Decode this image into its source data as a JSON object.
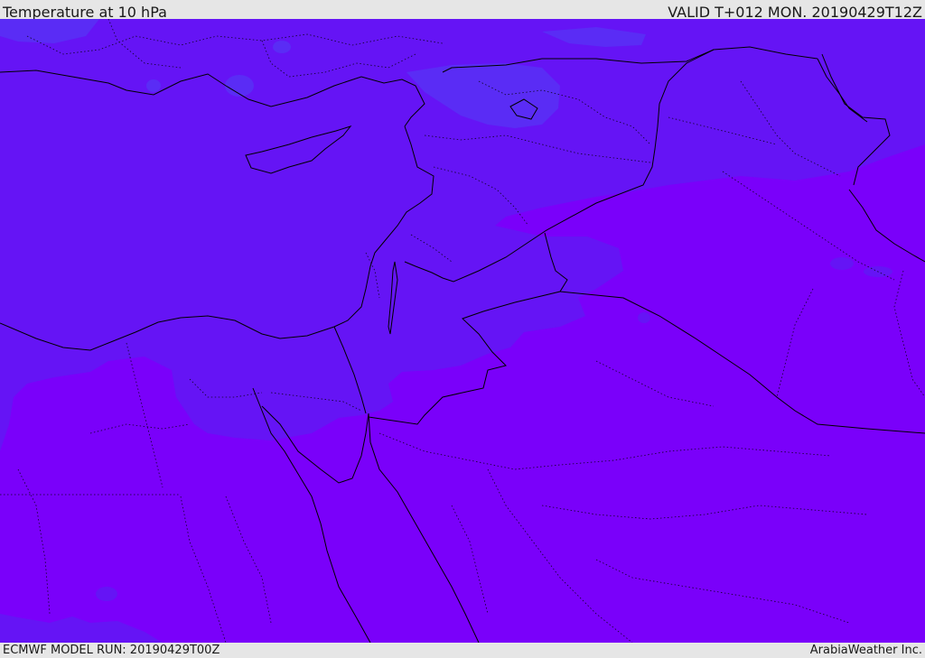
{
  "header": {
    "title": "Temperature at 10 hPa",
    "valid": "VALID T+012 MON. 20190429T12Z"
  },
  "footer": {
    "model_run": "ECMWF MODEL RUN: 20190429T00Z",
    "credit": "ArabiaWeather Inc."
  },
  "colors": {
    "warm_band": "#7a00fa",
    "mid_band": "#6514f5",
    "cool_band": "#5a2cf5",
    "border_line": "#000000",
    "frame": "#e6e6e6"
  }
}
